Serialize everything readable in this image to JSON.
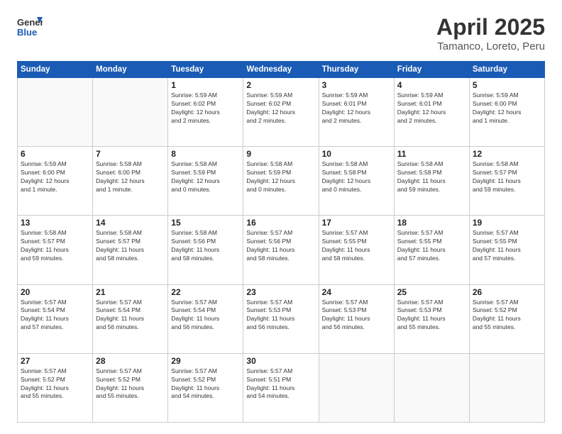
{
  "header": {
    "logo_line1": "General",
    "logo_line2": "Blue",
    "title": "April 2025",
    "subtitle": "Tamanco, Loreto, Peru"
  },
  "days_of_week": [
    "Sunday",
    "Monday",
    "Tuesday",
    "Wednesday",
    "Thursday",
    "Friday",
    "Saturday"
  ],
  "weeks": [
    [
      {
        "day": "",
        "detail": ""
      },
      {
        "day": "",
        "detail": ""
      },
      {
        "day": "1",
        "detail": "Sunrise: 5:59 AM\nSunset: 6:02 PM\nDaylight: 12 hours\nand 2 minutes."
      },
      {
        "day": "2",
        "detail": "Sunrise: 5:59 AM\nSunset: 6:02 PM\nDaylight: 12 hours\nand 2 minutes."
      },
      {
        "day": "3",
        "detail": "Sunrise: 5:59 AM\nSunset: 6:01 PM\nDaylight: 12 hours\nand 2 minutes."
      },
      {
        "day": "4",
        "detail": "Sunrise: 5:59 AM\nSunset: 6:01 PM\nDaylight: 12 hours\nand 2 minutes."
      },
      {
        "day": "5",
        "detail": "Sunrise: 5:59 AM\nSunset: 6:00 PM\nDaylight: 12 hours\nand 1 minute."
      }
    ],
    [
      {
        "day": "6",
        "detail": "Sunrise: 5:59 AM\nSunset: 6:00 PM\nDaylight: 12 hours\nand 1 minute."
      },
      {
        "day": "7",
        "detail": "Sunrise: 5:58 AM\nSunset: 6:00 PM\nDaylight: 12 hours\nand 1 minute."
      },
      {
        "day": "8",
        "detail": "Sunrise: 5:58 AM\nSunset: 5:59 PM\nDaylight: 12 hours\nand 0 minutes."
      },
      {
        "day": "9",
        "detail": "Sunrise: 5:58 AM\nSunset: 5:59 PM\nDaylight: 12 hours\nand 0 minutes."
      },
      {
        "day": "10",
        "detail": "Sunrise: 5:58 AM\nSunset: 5:58 PM\nDaylight: 12 hours\nand 0 minutes."
      },
      {
        "day": "11",
        "detail": "Sunrise: 5:58 AM\nSunset: 5:58 PM\nDaylight: 11 hours\nand 59 minutes."
      },
      {
        "day": "12",
        "detail": "Sunrise: 5:58 AM\nSunset: 5:57 PM\nDaylight: 11 hours\nand 59 minutes."
      }
    ],
    [
      {
        "day": "13",
        "detail": "Sunrise: 5:58 AM\nSunset: 5:57 PM\nDaylight: 11 hours\nand 59 minutes."
      },
      {
        "day": "14",
        "detail": "Sunrise: 5:58 AM\nSunset: 5:57 PM\nDaylight: 11 hours\nand 58 minutes."
      },
      {
        "day": "15",
        "detail": "Sunrise: 5:58 AM\nSunset: 5:56 PM\nDaylight: 11 hours\nand 58 minutes."
      },
      {
        "day": "16",
        "detail": "Sunrise: 5:57 AM\nSunset: 5:56 PM\nDaylight: 11 hours\nand 58 minutes."
      },
      {
        "day": "17",
        "detail": "Sunrise: 5:57 AM\nSunset: 5:55 PM\nDaylight: 11 hours\nand 58 minutes."
      },
      {
        "day": "18",
        "detail": "Sunrise: 5:57 AM\nSunset: 5:55 PM\nDaylight: 11 hours\nand 57 minutes."
      },
      {
        "day": "19",
        "detail": "Sunrise: 5:57 AM\nSunset: 5:55 PM\nDaylight: 11 hours\nand 57 minutes."
      }
    ],
    [
      {
        "day": "20",
        "detail": "Sunrise: 5:57 AM\nSunset: 5:54 PM\nDaylight: 11 hours\nand 57 minutes."
      },
      {
        "day": "21",
        "detail": "Sunrise: 5:57 AM\nSunset: 5:54 PM\nDaylight: 11 hours\nand 56 minutes."
      },
      {
        "day": "22",
        "detail": "Sunrise: 5:57 AM\nSunset: 5:54 PM\nDaylight: 11 hours\nand 56 minutes."
      },
      {
        "day": "23",
        "detail": "Sunrise: 5:57 AM\nSunset: 5:53 PM\nDaylight: 11 hours\nand 56 minutes."
      },
      {
        "day": "24",
        "detail": "Sunrise: 5:57 AM\nSunset: 5:53 PM\nDaylight: 11 hours\nand 56 minutes."
      },
      {
        "day": "25",
        "detail": "Sunrise: 5:57 AM\nSunset: 5:53 PM\nDaylight: 11 hours\nand 55 minutes."
      },
      {
        "day": "26",
        "detail": "Sunrise: 5:57 AM\nSunset: 5:52 PM\nDaylight: 11 hours\nand 55 minutes."
      }
    ],
    [
      {
        "day": "27",
        "detail": "Sunrise: 5:57 AM\nSunset: 5:52 PM\nDaylight: 11 hours\nand 55 minutes."
      },
      {
        "day": "28",
        "detail": "Sunrise: 5:57 AM\nSunset: 5:52 PM\nDaylight: 11 hours\nand 55 minutes."
      },
      {
        "day": "29",
        "detail": "Sunrise: 5:57 AM\nSunset: 5:52 PM\nDaylight: 11 hours\nand 54 minutes."
      },
      {
        "day": "30",
        "detail": "Sunrise: 5:57 AM\nSunset: 5:51 PM\nDaylight: 11 hours\nand 54 minutes."
      },
      {
        "day": "",
        "detail": ""
      },
      {
        "day": "",
        "detail": ""
      },
      {
        "day": "",
        "detail": ""
      }
    ]
  ]
}
